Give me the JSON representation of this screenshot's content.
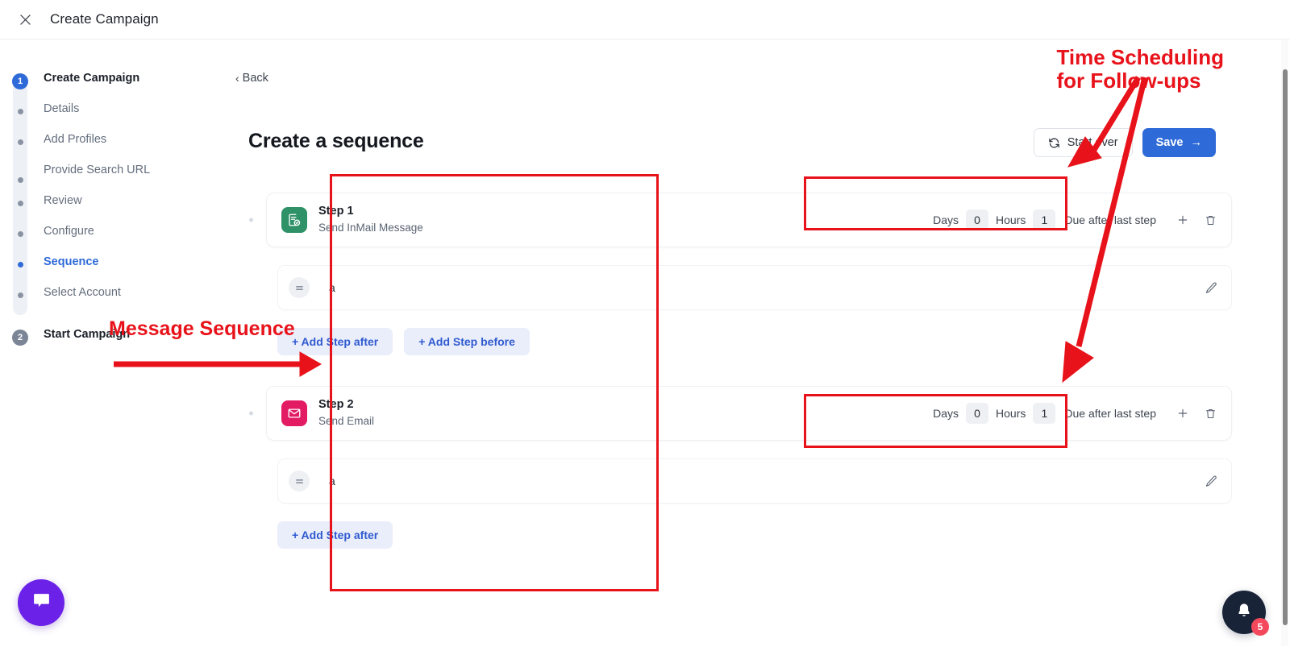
{
  "header": {
    "close_icon": "close-icon",
    "title": "Create Campaign"
  },
  "stepper": {
    "groups": [
      {
        "number": "1",
        "label": "Create Campaign",
        "items": [
          {
            "label": "Details",
            "active": false
          },
          {
            "label": "Add Profiles",
            "active": false
          },
          {
            "label": "Provide Search URL",
            "active": false
          },
          {
            "label": "Review",
            "active": false
          },
          {
            "label": "Configure",
            "active": false
          },
          {
            "label": "Sequence",
            "active": true
          },
          {
            "label": "Select Account",
            "active": false
          }
        ]
      },
      {
        "number": "2",
        "label": "Start Campaign",
        "items": []
      }
    ]
  },
  "main": {
    "back_label": "Back",
    "page_title": "Create a sequence",
    "start_over_label": "Start over",
    "save_label": "Save",
    "save_arrow": "→"
  },
  "sequence": {
    "steps": [
      {
        "icon": "inmail-message-icon",
        "icon_color": "#2e9168",
        "name": "Step 1",
        "subtitle": "Send InMail Message",
        "schedule": {
          "days_label": "Days",
          "days_value": "0",
          "hours_label": "Hours",
          "hours_value": "1",
          "due_label": "Due after last step"
        },
        "message": {
          "text": "a"
        },
        "add_buttons": [
          "+ Add Step after",
          "+ Add Step before"
        ]
      },
      {
        "icon": "email-icon",
        "icon_color": "#e31b63",
        "name": "Step 2",
        "subtitle": "Send Email",
        "schedule": {
          "days_label": "Days",
          "days_value": "0",
          "hours_label": "Hours",
          "hours_value": "1",
          "due_label": "Due after last step"
        },
        "message": {
          "text": "a"
        },
        "add_buttons": [
          "+ Add Step after"
        ]
      }
    ]
  },
  "annotations": {
    "color": "#e8121a",
    "time_scheduling_line1": "Time Scheduling",
    "time_scheduling_line2": "for Follow-ups",
    "message_sequence": "Message Sequence"
  },
  "widgets": {
    "chat_icon": "chat-bubble-icon",
    "notification_icon": "bell-icon",
    "notification_count": "5"
  }
}
